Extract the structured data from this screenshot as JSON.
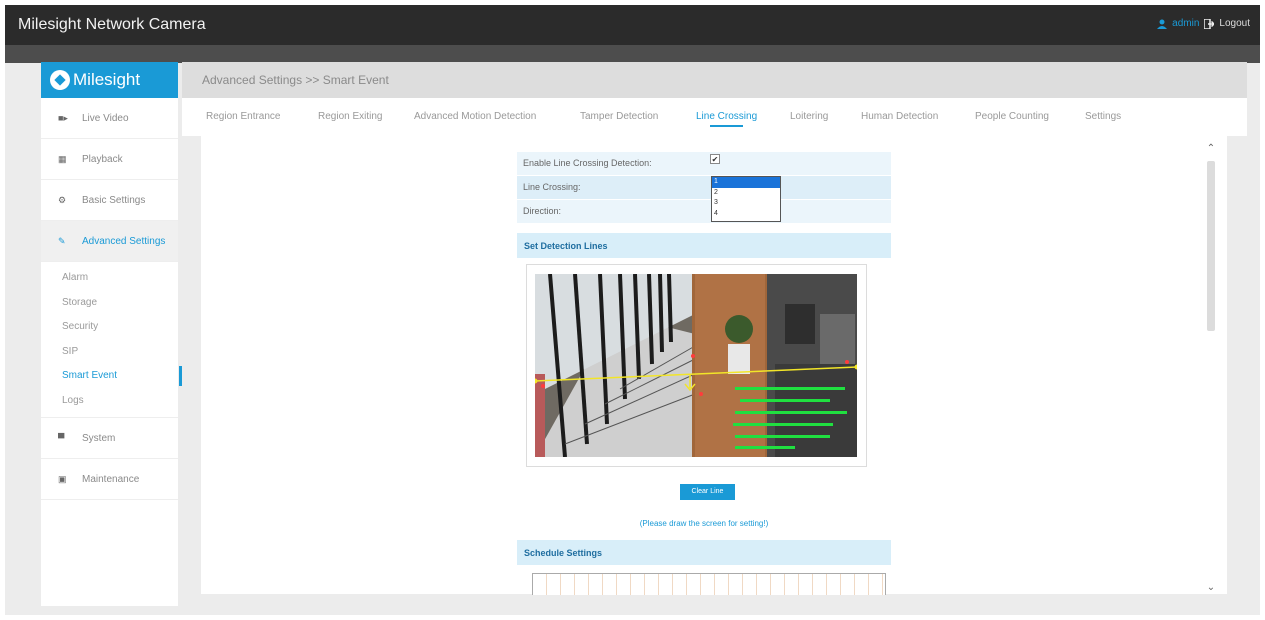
{
  "header": {
    "title": "Milesight Network Camera",
    "username": "admin",
    "logout_label": "Logout",
    "colors": {
      "bar": "#2b2b2b",
      "accent": "#1a9ad6"
    }
  },
  "sidebar": {
    "logo_text": "Milesight",
    "items": [
      {
        "label": "Live Video",
        "icon": "video-icon"
      },
      {
        "label": "Playback",
        "icon": "film-icon"
      },
      {
        "label": "Basic Settings",
        "icon": "gear-icon"
      },
      {
        "label": "Advanced Settings",
        "icon": "wrench-icon",
        "active": true
      },
      {
        "label": "System",
        "icon": "monitor-icon"
      },
      {
        "label": "Maintenance",
        "icon": "toolbox-icon"
      }
    ],
    "sub_items": [
      "Alarm",
      "Storage",
      "Security",
      "SIP",
      "Smart Event",
      "Logs"
    ],
    "active_sub_item": "Smart Event"
  },
  "breadcrumb": "Advanced Settings >> Smart Event",
  "tabs": [
    "Region Entrance",
    "Region Exiting",
    "Advanced Motion Detection",
    "Tamper Detection",
    "Line Crossing",
    "Loitering",
    "Human Detection",
    "People Counting",
    "Settings"
  ],
  "active_tab": "Line Crossing",
  "form": {
    "enable_label": "Enable Line Crossing Detection:",
    "enable_checked": true,
    "line_crossing_label": "Line Crossing:",
    "direction_label": "Direction:",
    "line_options": [
      "1",
      "2",
      "3",
      "4"
    ],
    "line_selected": "1",
    "detection_section": "Set Detection Lines",
    "clear_button": "Clear Line",
    "hint": "(Please draw the screen for setting!)",
    "schedule_section": "Schedule Settings"
  }
}
